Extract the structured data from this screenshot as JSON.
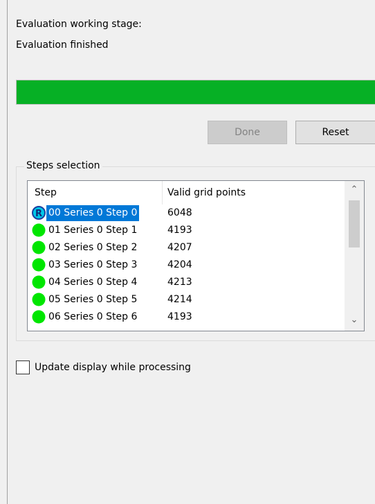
{
  "status": {
    "stage_label": "Evaluation working stage:",
    "stage_value": "Evaluation finished",
    "progress_percent": 100
  },
  "buttons": {
    "done": "Done",
    "reset": "Reset"
  },
  "steps_selection": {
    "title": "Steps selection",
    "columns": [
      "Step",
      "Valid grid points"
    ],
    "rows": [
      {
        "step": "00 Series 0 Step 0",
        "valid": "6048",
        "icon": "reference-r-icon",
        "selected": true
      },
      {
        "step": "01 Series 0 Step 1",
        "valid": "4193",
        "icon": "green-dot-icon",
        "selected": false
      },
      {
        "step": "02 Series 0 Step 2",
        "valid": "4207",
        "icon": "green-dot-icon",
        "selected": false
      },
      {
        "step": "03 Series 0 Step 3",
        "valid": "4204",
        "icon": "green-dot-icon",
        "selected": false
      },
      {
        "step": "04 Series 0 Step 4",
        "valid": "4213",
        "icon": "green-dot-icon",
        "selected": false
      },
      {
        "step": "05 Series 0 Step 5",
        "valid": "4214",
        "icon": "green-dot-icon",
        "selected": false
      },
      {
        "step": "06 Series 0 Step 6",
        "valid": "4193",
        "icon": "green-dot-icon",
        "selected": false
      }
    ]
  },
  "options": {
    "update_display_label": "Update display while processing",
    "update_display_checked": false
  },
  "colors": {
    "progress_fill": "#06b025",
    "selection": "#0078d7",
    "status_dot": "#00e600"
  }
}
